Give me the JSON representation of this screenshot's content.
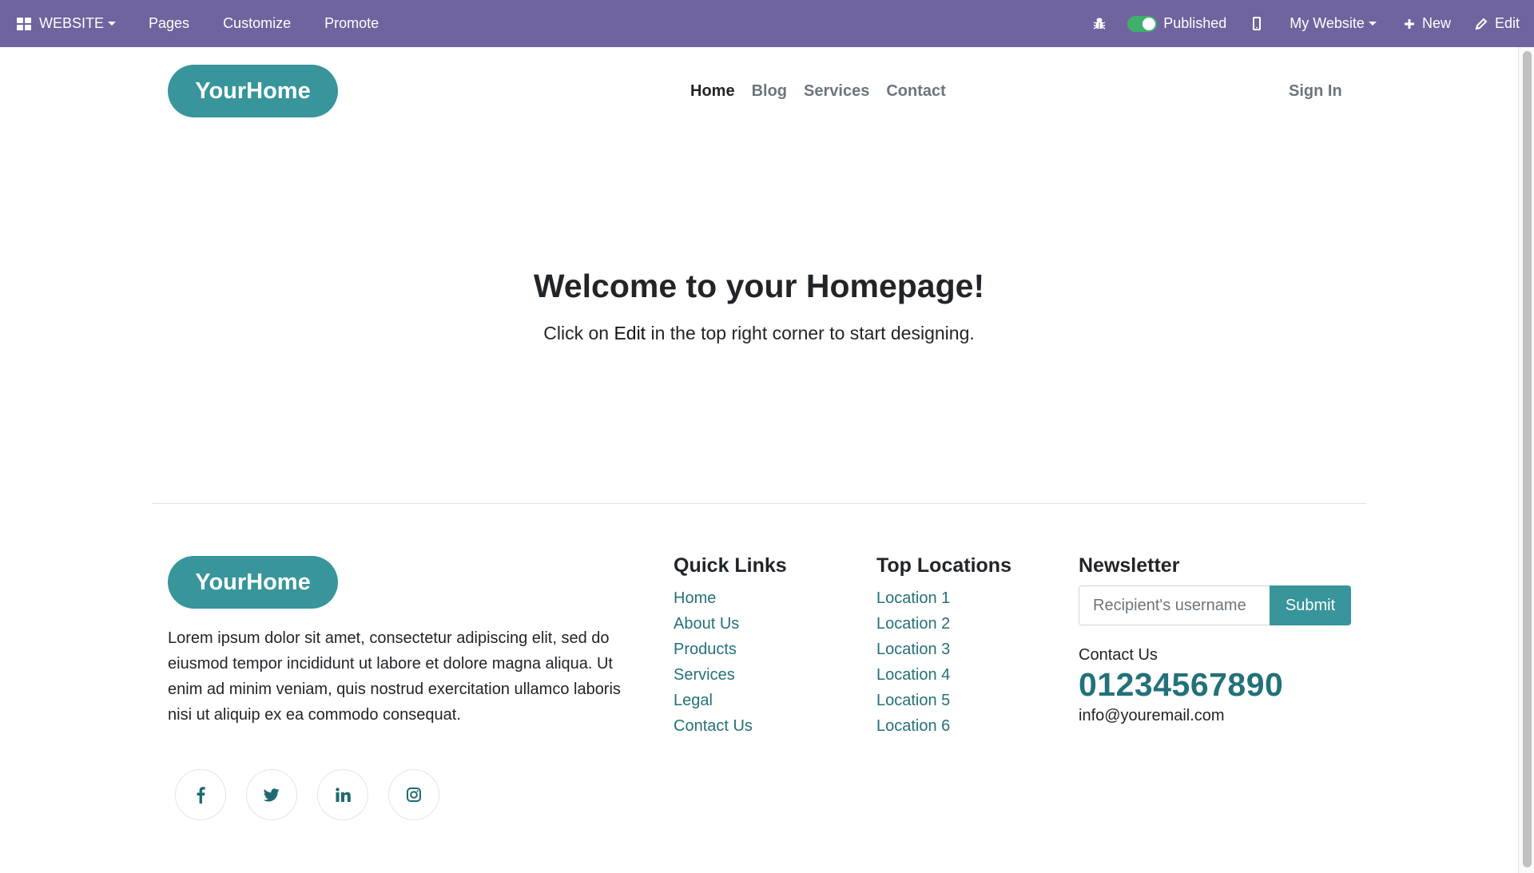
{
  "topbar": {
    "app_label": "WEBSITE",
    "menu": [
      "Pages",
      "Customize",
      "Promote"
    ],
    "published_label": "Published",
    "published": true,
    "site_label": "My Website",
    "new_label": "New",
    "edit_label": "Edit",
    "icons": {
      "app": "grid-icon",
      "debug": "bug-icon",
      "mobile": "mobile-phone-icon",
      "new": "plus-icon",
      "edit": "pencil-icon"
    }
  },
  "header": {
    "logo": "YourHome",
    "nav": [
      {
        "label": "Home",
        "active": true
      },
      {
        "label": "Blog",
        "active": false
      },
      {
        "label": "Services",
        "active": false
      },
      {
        "label": "Contact",
        "active": false
      }
    ],
    "sign_in": "Sign In"
  },
  "hero": {
    "title": "Welcome to your Homepage!",
    "subtitle_before": "Click on ",
    "subtitle_bold": "Edit",
    "subtitle_after": " in the top right corner to start designing."
  },
  "footer": {
    "logo": "YourHome",
    "about": "Lorem ipsum dolor sit amet, consectetur adipiscing elit, sed do eiusmod tempor incididunt ut labore et dolore magna aliqua. Ut enim ad minim veniam, quis nostrud exercitation ullamco laboris nisi ut aliquip ex ea commodo consequat.",
    "socials": [
      "facebook-icon",
      "twitter-icon",
      "linkedin-icon",
      "instagram-icon"
    ],
    "quick_links": {
      "title": "Quick Links",
      "items": [
        "Home",
        "About Us",
        "Products",
        "Services",
        "Legal",
        "Contact Us"
      ]
    },
    "top_locations": {
      "title": "Top Locations",
      "items": [
        "Location 1",
        "Location 2",
        "Location 3",
        "Location 4",
        "Location 5",
        "Location 6"
      ]
    },
    "newsletter": {
      "title": "Newsletter",
      "placeholder": "Recipient's username",
      "value": "",
      "submit_label": "Submit",
      "contact_label": "Contact Us",
      "phone": "01234567890",
      "email": "info@youremail.com"
    }
  },
  "colors": {
    "topbar": "#71639e",
    "brand": "#37959b",
    "link": "#23717a",
    "toggle_on": "#3eb06b"
  }
}
